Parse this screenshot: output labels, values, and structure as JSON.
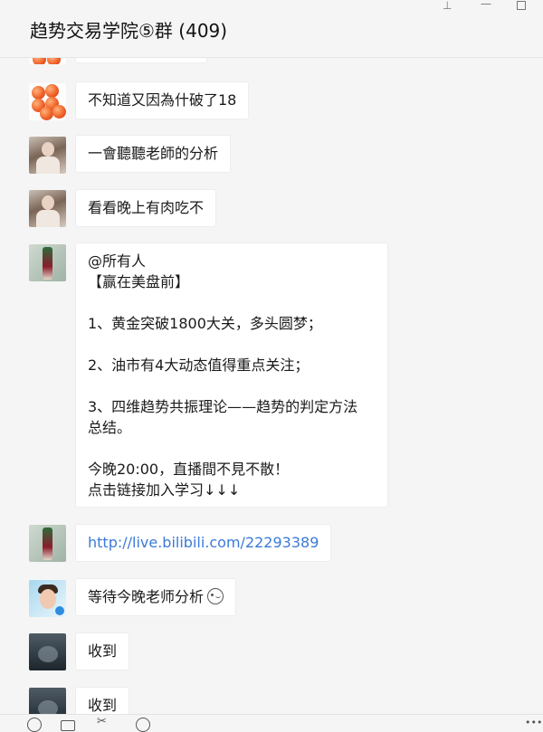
{
  "window": {
    "title": "趋势交易学院⑤群 (409)"
  },
  "messages": [
    {
      "sender_avatar": "orange-balls-avatar",
      "text": "不知道又因為什破了18"
    },
    {
      "sender_avatar": "girl-avatar",
      "text": "一會聽聽老師的分析"
    },
    {
      "sender_avatar": "girl-avatar",
      "text": "看看晚上有肉吃不"
    },
    {
      "sender_avatar": "bottle-avatar",
      "notice": {
        "line1": "@所有人",
        "line2": "【赢在美盘前】",
        "line3": "1、黄金突破1800大关，多头圆梦；",
        "line4": "2、油市有4大动态值得重点关注；",
        "line5": "3、四维趋势共振理论——趋势的判定方法",
        "line6": "总结。",
        "line7": "今晚20:00，直播間不見不散！",
        "line8": "点击链接加入学习↓↓↓"
      }
    },
    {
      "sender_avatar": "bottle-avatar",
      "text": "http://live.bilibili.com/22293389"
    },
    {
      "sender_avatar": "boy-avatar",
      "text": "等待今晚老师分析"
    },
    {
      "sender_avatar": "dark-avatar",
      "text": "收到"
    },
    {
      "sender_avatar": "dark-avatar",
      "text": "收到"
    }
  ]
}
